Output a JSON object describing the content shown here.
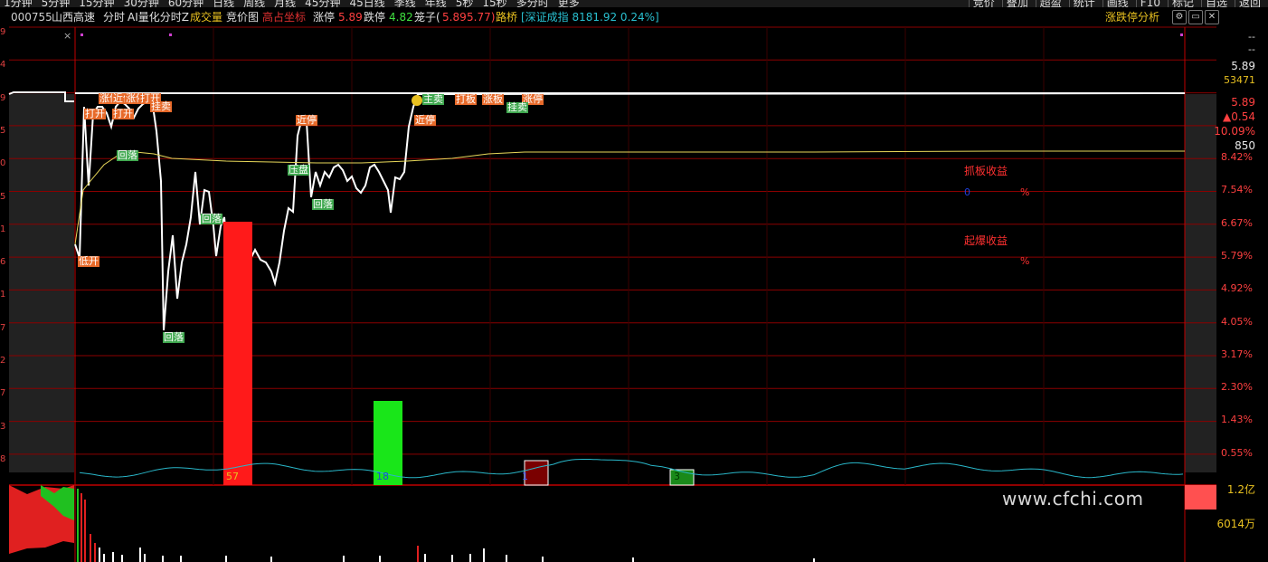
{
  "top_menu": {
    "periods": [
      "1分钟",
      "5分钟",
      "15分钟",
      "30分钟",
      "60分钟",
      "日线",
      "周线",
      "月线",
      "45分钟",
      "45日线",
      "季线",
      "年线",
      "5秒",
      "15秒",
      "多分时",
      "更多"
    ],
    "tools": [
      "竞价",
      "叠加",
      "超盈",
      "统计",
      "画线",
      "F10",
      "标记",
      "自选",
      "返回"
    ]
  },
  "info_bar": {
    "stock_code": "000755",
    "stock_name": "山西高速",
    "mode": "分时",
    "indicator": "AI量化分时Z",
    "volume_label": "成交量",
    "auction_label": "竞价图",
    "highlight_label": "高占坐标",
    "limit_up_label": "涨停",
    "limit_up_value": "5.89",
    "limit_down_label": "跌停",
    "limit_down_value": "4.82",
    "cage_label": "笼子(",
    "cage_v1": "5.89",
    "cage_v2": "5.77)",
    "road_label": "路桥",
    "index_text": "[深证成指 8181.92 0.24%]",
    "analysis_button": "涨跌停分析"
  },
  "left_axis_fragments": [
    "9",
    "4",
    "9",
    "5",
    "0",
    "5",
    "1",
    "6",
    "1",
    "7",
    "2",
    "7",
    "3",
    "8"
  ],
  "right_axis": {
    "dash1": "--",
    "dash2": "--",
    "price": "5.89",
    "volume": "53471",
    "price2": "5.89",
    "change": "▲0.54",
    "change_pct": "10.09%",
    "handover": "850",
    "pct_ticks": [
      "8.42%",
      "7.54%",
      "6.67%",
      "5.79%",
      "4.92%",
      "4.05%",
      "3.17%",
      "2.30%",
      "1.43%",
      "0.55%"
    ],
    "vol_high": "1.2亿",
    "vol_mid": "6014万"
  },
  "signal_tags": {
    "huixing": "回落",
    "dipan": "低开",
    "zhuangpan": "压盘",
    "kaiban": "打开",
    "zhangting": "涨停",
    "jinting": "近停",
    "guamai": "挂卖",
    "zhumai": "主卖",
    "daban": "打板",
    "zhangban": "涨板",
    "cheng": "承",
    "tiban": "铁板"
  },
  "panel": {
    "grab_profit_label": "抓板收益",
    "grab_profit_value": "0",
    "grab_profit_unit": "%",
    "burst_profit_label": "起爆收益",
    "burst_profit_unit": "%"
  },
  "bar_labels": {
    "red": "57",
    "green": "18",
    "dark": "1",
    "small": "3"
  },
  "watermark": "www.cfchi.com",
  "colors": {
    "grid": "#8b0000",
    "price_line": "#ffffff",
    "avg_line": "#e8d85a",
    "volume_line": "#29b6c8",
    "red_bar": "#ff1a1a",
    "green_bar": "#19e619",
    "dark_bar": "#7a0000",
    "accent_yellow": "#e8c020"
  }
}
